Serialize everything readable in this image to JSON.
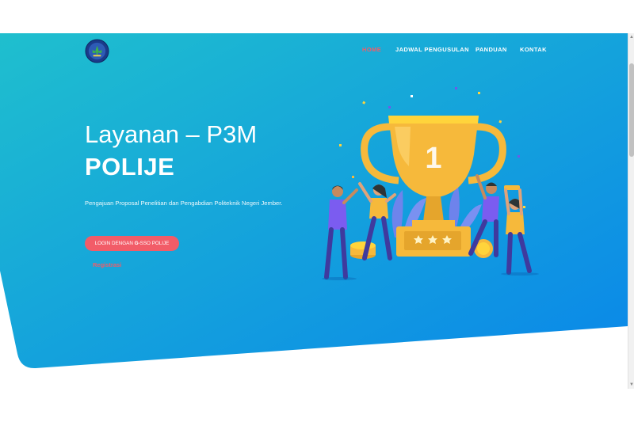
{
  "nav": {
    "items": [
      {
        "label": "HOME",
        "active": true
      },
      {
        "label": "JADWAL PENGUSULAN",
        "active": false
      },
      {
        "label": "PANDUAN",
        "active": false
      },
      {
        "label": "KONTAK",
        "active": false
      }
    ]
  },
  "hero": {
    "title_line1": "Layanan – P3M",
    "title_line2": "POLIJE",
    "description": "Pengajuan Proposal Penelitian dan Pengabdian Politeknik Negeri Jember.",
    "login_button": {
      "prefix": "LOGIN DENGAN ",
      "g_mark": "G-",
      "suffix": "SSO POLIJE"
    },
    "register_label": "Registrasi"
  },
  "illustration": {
    "trophy_number": "1"
  },
  "colors": {
    "gradient_start": "#1fbfce",
    "gradient_end": "#0a87e9",
    "accent": "#f25c68",
    "trophy_gold": "#f6b93b"
  }
}
